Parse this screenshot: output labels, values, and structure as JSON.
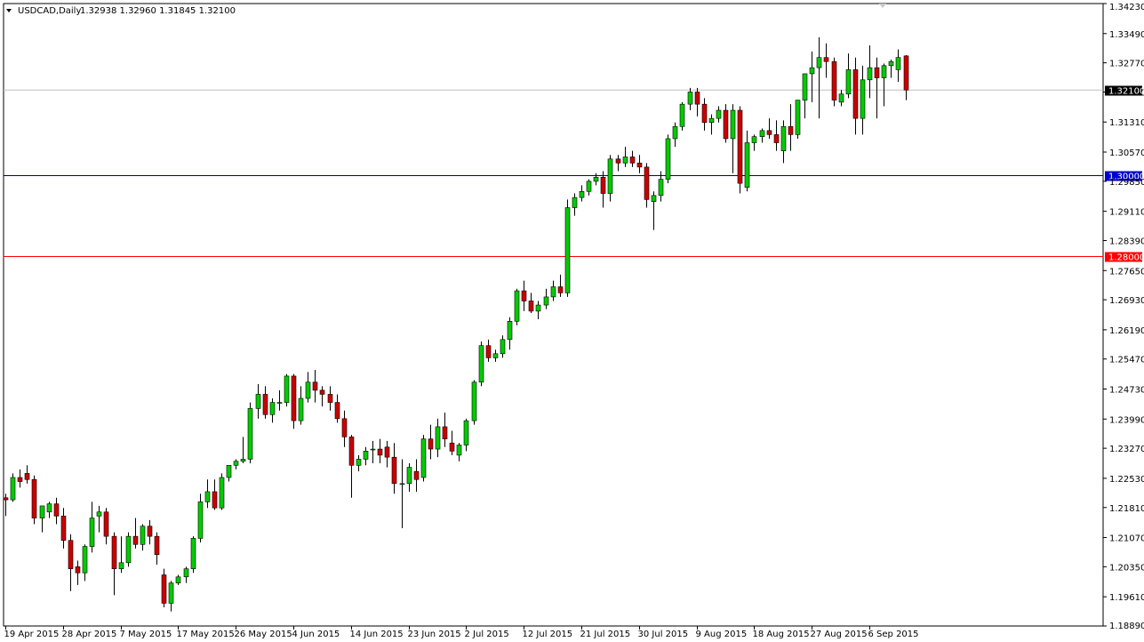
{
  "header": {
    "symbol": "USDCAD,Daily",
    "ohlc": "1.32938 1.32960 1.31845 1.32100"
  },
  "chart_data": {
    "type": "candlestick",
    "symbol": "USDCAD",
    "timeframe": "Daily",
    "ylim": [
      1.1889,
      1.3423
    ],
    "y_ticks": [
      "1.34230",
      "1.33490",
      "1.32770",
      "1.32050",
      "1.31310",
      "1.30570",
      "1.29850",
      "1.29110",
      "1.28390",
      "1.27650",
      "1.26930",
      "1.26190",
      "1.25470",
      "1.24730",
      "1.23990",
      "1.23270",
      "1.22530",
      "1.21810",
      "1.21070",
      "1.20350",
      "1.19610",
      "1.18890"
    ],
    "x_labels": [
      "19 Apr 2015",
      "28 Apr 2015",
      "7 May 2015",
      "17 May 2015",
      "26 May 2015",
      "4 Jun 2015",
      "14 Jun 2015",
      "23 Jun 2015",
      "2 Jul 2015",
      "12 Jul 2015",
      "21 Jul 2015",
      "30 Jul 2015",
      "9 Aug 2015",
      "18 Aug 2015",
      "27 Aug 2015",
      "6 Sep 2015"
    ],
    "x_label_candle_index": [
      0,
      8,
      16,
      24,
      32,
      40,
      48,
      56,
      64,
      72,
      80,
      88,
      96,
      104,
      112,
      120
    ],
    "current_price": "1.32100",
    "levels": [
      {
        "price": "1.30000",
        "value": 1.3,
        "color": "#000080",
        "label_bg": "#0000cc"
      },
      {
        "price": "1.28000",
        "value": 1.28,
        "color": "#ff0000",
        "label_bg": "#ff0000"
      }
    ],
    "colors": {
      "bull": "#00cc00",
      "bear": "#cc0000",
      "wick": "#000000",
      "grid_line": "#c0c0c0",
      "current_label_bg": "#000000"
    },
    "candles": [
      [
        1.2205,
        1.2215,
        1.216,
        1.22
      ],
      [
        1.22,
        1.2265,
        1.2195,
        1.2255
      ],
      [
        1.2255,
        1.2275,
        1.223,
        1.2245
      ],
      [
        1.2265,
        1.2285,
        1.224,
        1.225
      ],
      [
        1.225,
        1.226,
        1.214,
        1.2155
      ],
      [
        1.2155,
        1.2175,
        1.212,
        1.2185
      ],
      [
        1.217,
        1.2195,
        1.2155,
        1.219
      ],
      [
        1.219,
        1.2205,
        1.214,
        1.216
      ],
      [
        1.216,
        1.218,
        1.208,
        1.21
      ],
      [
        1.21,
        1.2115,
        1.1975,
        1.203
      ],
      [
        1.2035,
        1.205,
        1.199,
        1.202
      ],
      [
        1.202,
        1.209,
        1.2,
        1.2085
      ],
      [
        1.2085,
        1.2195,
        1.207,
        1.2155
      ],
      [
        1.216,
        1.2185,
        1.212,
        1.217
      ],
      [
        1.217,
        1.218,
        1.209,
        1.211
      ],
      [
        1.211,
        1.212,
        1.1965,
        1.203
      ],
      [
        1.203,
        1.211,
        1.202,
        1.2045
      ],
      [
        1.2045,
        1.212,
        1.2035,
        1.211
      ],
      [
        1.211,
        1.2155,
        1.208,
        1.209
      ],
      [
        1.209,
        1.214,
        1.2075,
        1.2135
      ],
      [
        1.2135,
        1.215,
        1.209,
        1.211
      ],
      [
        1.211,
        1.212,
        1.204,
        1.2065
      ],
      [
        1.2015,
        1.203,
        1.1935,
        1.1945
      ],
      [
        1.1945,
        1.2,
        1.1925,
        1.1995
      ],
      [
        1.1995,
        1.2015,
        1.199,
        1.201
      ],
      [
        1.201,
        1.2035,
        1.1995,
        1.203
      ],
      [
        1.203,
        1.211,
        1.202,
        1.2105
      ],
      [
        1.2105,
        1.2215,
        1.2095,
        1.2195
      ],
      [
        1.2195,
        1.225,
        1.218,
        1.222
      ],
      [
        1.222,
        1.225,
        1.2175,
        1.218
      ],
      [
        1.218,
        1.2265,
        1.2175,
        1.2255
      ],
      [
        1.2255,
        1.2285,
        1.2245,
        1.2285
      ],
      [
        1.2285,
        1.23,
        1.2275,
        1.2295
      ],
      [
        1.2295,
        1.2355,
        1.229,
        1.23
      ],
      [
        1.23,
        1.244,
        1.229,
        1.2425
      ],
      [
        1.2425,
        1.2485,
        1.24,
        1.246
      ],
      [
        1.246,
        1.248,
        1.24,
        1.241
      ],
      [
        1.241,
        1.245,
        1.239,
        1.244
      ],
      [
        1.244,
        1.247,
        1.242,
        1.244
      ],
      [
        1.244,
        1.251,
        1.243,
        1.2505
      ],
      [
        1.2505,
        1.251,
        1.2375,
        1.2395
      ],
      [
        1.2395,
        1.248,
        1.2385,
        1.245
      ],
      [
        1.245,
        1.2515,
        1.244,
        1.249
      ],
      [
        1.249,
        1.252,
        1.244,
        1.247
      ],
      [
        1.247,
        1.248,
        1.243,
        1.246
      ],
      [
        1.246,
        1.248,
        1.242,
        1.244
      ],
      [
        1.244,
        1.246,
        1.239,
        1.24
      ],
      [
        1.24,
        1.242,
        1.233,
        1.2355
      ],
      [
        1.2355,
        1.236,
        1.2205,
        1.2285
      ],
      [
        1.2285,
        1.231,
        1.227,
        1.23
      ],
      [
        1.23,
        1.233,
        1.2285,
        1.232
      ],
      [
        1.2325,
        1.2345,
        1.229,
        1.2325
      ],
      [
        1.2325,
        1.235,
        1.229,
        1.231
      ],
      [
        1.233,
        1.2345,
        1.228,
        1.2305
      ],
      [
        1.2305,
        1.234,
        1.2215,
        1.224
      ],
      [
        1.224,
        1.23,
        1.213,
        1.224
      ],
      [
        1.224,
        1.229,
        1.222,
        1.228
      ],
      [
        1.227,
        1.23,
        1.222,
        1.225
      ],
      [
        1.2255,
        1.236,
        1.2245,
        1.235
      ],
      [
        1.235,
        1.2385,
        1.23,
        1.2325
      ],
      [
        1.2325,
        1.24,
        1.2305,
        1.238
      ],
      [
        1.238,
        1.2415,
        1.233,
        1.235
      ],
      [
        1.234,
        1.237,
        1.231,
        1.232
      ],
      [
        1.231,
        1.234,
        1.2295,
        1.2335
      ],
      [
        1.2335,
        1.24,
        1.232,
        1.2395
      ],
      [
        1.2395,
        1.2495,
        1.2385,
        1.249
      ],
      [
        1.249,
        1.259,
        1.248,
        1.258
      ],
      [
        1.258,
        1.2595,
        1.254,
        1.255
      ],
      [
        1.255,
        1.257,
        1.254,
        1.256
      ],
      [
        1.256,
        1.2605,
        1.255,
        1.2595
      ],
      [
        1.2595,
        1.265,
        1.257,
        1.264
      ],
      [
        1.264,
        1.272,
        1.263,
        1.2715
      ],
      [
        1.2715,
        1.274,
        1.2665,
        1.269
      ],
      [
        1.269,
        1.271,
        1.266,
        1.2665
      ],
      [
        1.2665,
        1.269,
        1.2645,
        1.268
      ],
      [
        1.268,
        1.272,
        1.267,
        1.27
      ],
      [
        1.27,
        1.274,
        1.269,
        1.2725
      ],
      [
        1.2725,
        1.2755,
        1.27,
        1.271
      ],
      [
        1.271,
        1.294,
        1.27,
        1.292
      ],
      [
        1.292,
        1.2955,
        1.29,
        1.2945
      ],
      [
        1.2945,
        1.2975,
        1.2935,
        1.296
      ],
      [
        1.296,
        1.299,
        1.295,
        1.2985
      ],
      [
        1.2985,
        1.3005,
        1.2975,
        1.2995
      ],
      [
        1.2995,
        1.301,
        1.292,
        1.2955
      ],
      [
        1.2955,
        1.305,
        1.2935,
        1.304
      ],
      [
        1.304,
        1.305,
        1.301,
        1.303
      ],
      [
        1.303,
        1.307,
        1.302,
        1.3045
      ],
      [
        1.3045,
        1.306,
        1.302,
        1.303
      ],
      [
        1.303,
        1.305,
        1.3005,
        1.302
      ],
      [
        1.302,
        1.303,
        1.292,
        1.294
      ],
      [
        1.2935,
        1.296,
        1.2865,
        1.295
      ],
      [
        1.295,
        1.301,
        1.2935,
        1.299
      ],
      [
        1.299,
        1.31,
        1.298,
        1.309
      ],
      [
        1.309,
        1.313,
        1.307,
        1.312
      ],
      [
        1.312,
        1.318,
        1.311,
        1.3175
      ],
      [
        1.3175,
        1.3215,
        1.316,
        1.3205
      ],
      [
        1.3205,
        1.3215,
        1.3145,
        1.3175
      ],
      [
        1.3175,
        1.319,
        1.311,
        1.313
      ],
      [
        1.313,
        1.315,
        1.31,
        1.314
      ],
      [
        1.314,
        1.317,
        1.313,
        1.316
      ],
      [
        1.316,
        1.3175,
        1.308,
        1.309
      ],
      [
        1.309,
        1.3175,
        1.3005,
        1.316
      ],
      [
        1.316,
        1.317,
        1.2955,
        1.298
      ],
      [
        1.297,
        1.311,
        1.296,
        1.308
      ],
      [
        1.308,
        1.31,
        1.306,
        1.3095
      ],
      [
        1.3095,
        1.3115,
        1.308,
        1.311
      ],
      [
        1.311,
        1.314,
        1.309,
        1.31
      ],
      [
        1.31,
        1.3135,
        1.306,
        1.308
      ],
      [
        1.306,
        1.3135,
        1.303,
        1.312
      ],
      [
        1.312,
        1.3175,
        1.306,
        1.31
      ],
      [
        1.31,
        1.3185,
        1.309,
        1.3185
      ],
      [
        1.3185,
        1.324,
        1.314,
        1.325
      ],
      [
        1.325,
        1.3305,
        1.318,
        1.3265
      ],
      [
        1.3265,
        1.334,
        1.314,
        1.329
      ],
      [
        1.329,
        1.3325,
        1.324,
        1.328
      ],
      [
        1.328,
        1.329,
        1.317,
        1.3185
      ],
      [
        1.318,
        1.321,
        1.317,
        1.32
      ],
      [
        1.32,
        1.33,
        1.319,
        1.326
      ],
      [
        1.326,
        1.329,
        1.31,
        1.314
      ],
      [
        1.314,
        1.327,
        1.31,
        1.3235
      ],
      [
        1.3235,
        1.332,
        1.319,
        1.3265
      ],
      [
        1.3265,
        1.329,
        1.314,
        1.324
      ],
      [
        1.324,
        1.3275,
        1.317,
        1.327
      ],
      [
        1.327,
        1.3285,
        1.324,
        1.328
      ],
      [
        1.326,
        1.331,
        1.323,
        1.329
      ],
      [
        1.3294,
        1.3296,
        1.3185,
        1.321
      ]
    ]
  }
}
